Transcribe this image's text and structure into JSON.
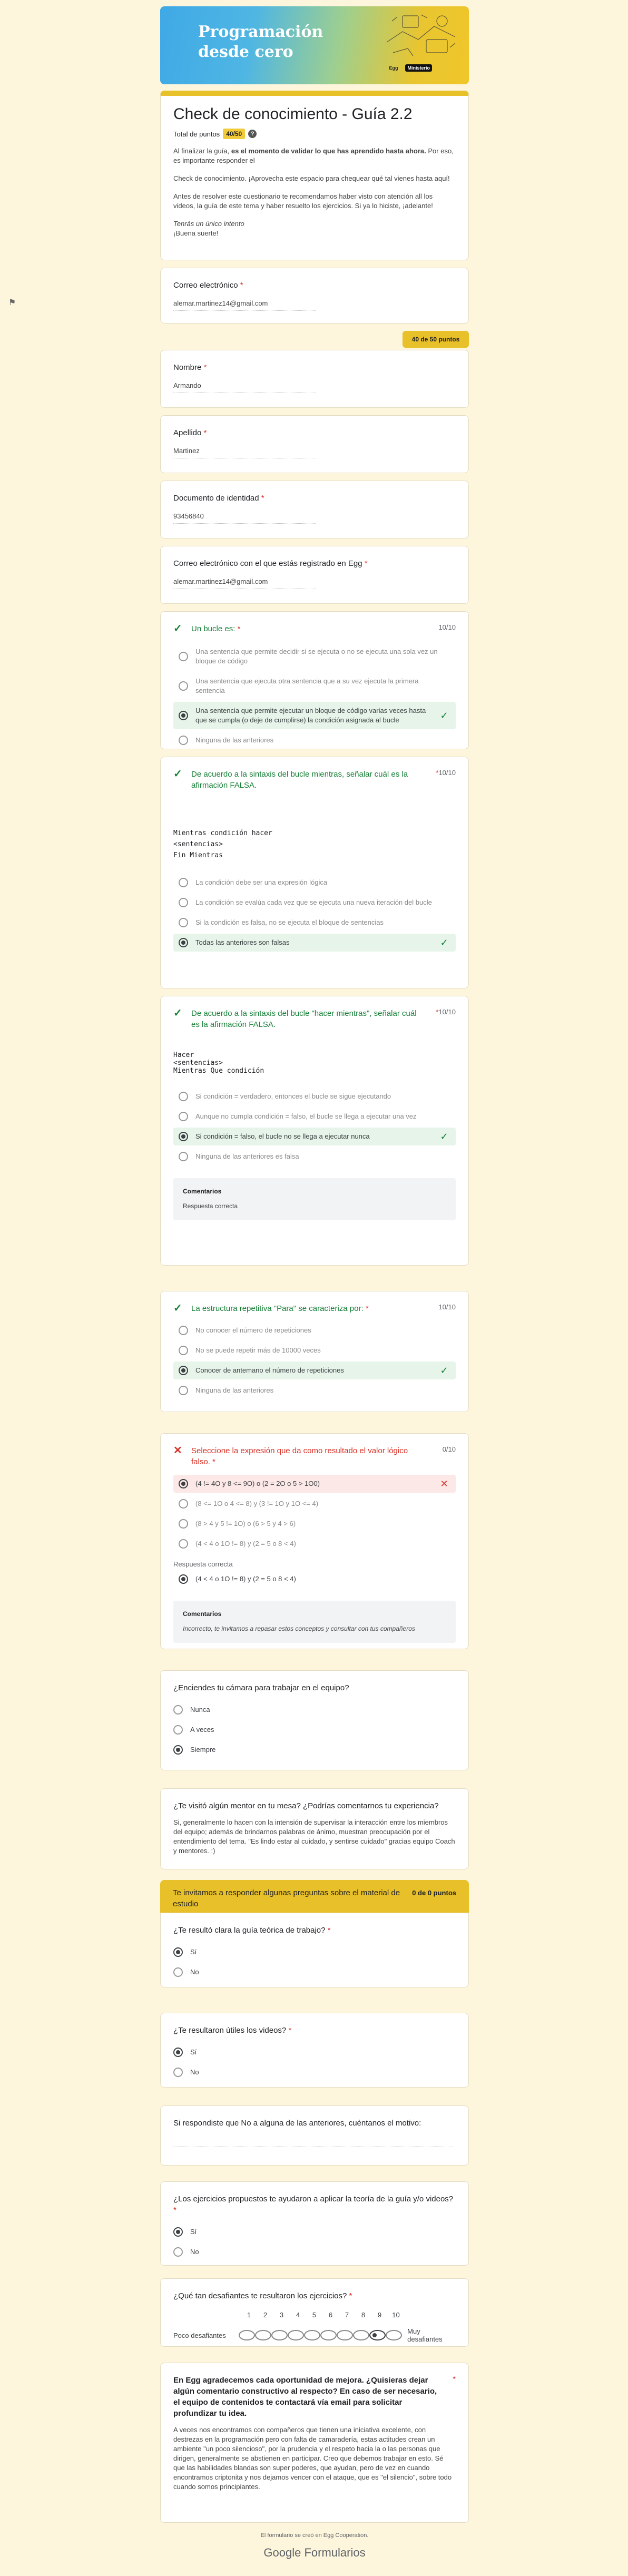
{
  "banner": {
    "title": "Programación desde cero",
    "logo_a": "Egg",
    "logo_b": "Ministerio"
  },
  "form": {
    "title": "Check de conocimiento - Guía 2.2",
    "points_label": "Total de puntos",
    "points_value": "40/50",
    "intro_1a": "Al finalizar la guía,",
    "intro_1b": "es el momento de validar lo que has aprendido hasta ahora.",
    "intro_1c": "Por eso, es importante responder el",
    "intro_2": "Check de conocimiento. ¡Aprovecha este espacio para chequear qué tal vienes hasta aquí!",
    "intro_3": "Antes de resolver este cuestionario te recomendamos haber visto con atención all los videos, la guía de este tema y haber resuelto los ejercicios. Si ya lo hiciste, ¡adelante!",
    "intro_4": "Tenrás un único intento",
    "intro_5": "¡Buena suerte!"
  },
  "email": {
    "label": "Correo electrónico",
    "value": "alemar.martinez14@gmail.com"
  },
  "points_tab": "40 de 50 puntos",
  "nombre": {
    "label": "Nombre",
    "value": "Armando"
  },
  "apellido": {
    "label": "Apellido",
    "value": "Martinez"
  },
  "documento": {
    "label": "Documento de identidad",
    "value": "93456840"
  },
  "egg_email": {
    "label": "Correo electrónico con el que estás registrado en Egg",
    "value": "alemar.martinez14@gmail.com"
  },
  "q1": {
    "title": "Un bucle es:",
    "score": "10/10",
    "options": [
      "Una sentencia que permite decidir si se ejecuta o no se ejecuta una sola vez un bloque de código",
      "Una sentencia que ejecuta otra sentencia que a su vez ejecuta la primera sentencia",
      "Una sentencia que permite ejecutar un bloque de código varias veces hasta que se cumpla (o deje de cumplirse) la condición asignada al bucle",
      "Ninguna de las anteriores"
    ]
  },
  "q2": {
    "title": "De acuerdo a la sintaxis del bucle mientras, señalar cuál es la afirmación FALSA.",
    "score": "10/10",
    "code": "Mientras condición hacer\n<sentencias>\nFin Mientras",
    "options": [
      "La condición debe ser una expresión lógica",
      "La condición se evalúa cada vez que se ejecuta una nueva iteración del bucle",
      "Si la condición es falsa, no se ejecuta el bloque de sentencias",
      "Todas las anteriores son falsas"
    ]
  },
  "q3": {
    "title": "De acuerdo a la sintaxis del bucle \"hacer mientras\", señalar cuál es la afirmación FALSA.",
    "score": "10/10",
    "code": "Hacer\n<sentencias>\nMientras Que condición",
    "options": [
      "Si condición = verdadero, entonces el bucle se sigue ejecutando",
      "Aunque no cumpla condición = falso, el bucle se llega a ejecutar una vez",
      "Si condición = falso, el bucle no se llega a ejecutar nunca",
      "Ninguna de las anteriores es falsa"
    ],
    "feedback_title": "Comentarios",
    "feedback_text": "Respuesta correcta"
  },
  "q4": {
    "title": "La estructura repetitiva \"Para\" se caracteriza por:",
    "score": "10/10",
    "options": [
      "No conocer el número de repeticiones",
      "No se puede repetir más de 10000 veces",
      "Conocer de antemano el número de repeticiones",
      "Ninguna de las anteriores"
    ]
  },
  "q5": {
    "title": "Seleccione la expresión que da como resultado el valor lógico falso.",
    "score": "0/10",
    "options": [
      "(4 != 4O y 8 <= 9O) o (2 = 2O o 5 > 1O0)",
      "(8 <= 1O o 4 <= 8) y (3 != 1O y 1O <= 4)",
      "(8 > 4 y 5 != 1O) o (6 > 5 y 4 > 6)",
      "(4 < 4 o 1O != 8) y (2 = 5 o 8 < 4)"
    ],
    "correct_label": "Respuesta correcta",
    "correct_option": "(4 < 4 o 1O != 8) y (2 = 5 o 8 < 4)",
    "feedback_title": "Comentarios",
    "feedback_text": "Incorrecto, te invitamos a repasar estos conceptos y consultar con tus compañeros"
  },
  "camera": {
    "title": "¿Enciendes tu cámara para trabajar en el equipo?",
    "options": [
      "Nunca",
      "A veces",
      "Siempre"
    ]
  },
  "mentor": {
    "title": "¿Te visitó algún mentor en tu mesa? ¿Podrías comentarnos tu experiencia?",
    "answer": "Si, generalmente lo hacen con la intensión de supervisar la interacción entre los miembros del equipo; además de brindarnos palabras de ánimo, muestran preocupación por el entendimiento del tema. \"Es lindo estar al cuidado, y sentirse cuidado\" gracias equipo Coach y mentores. :)"
  },
  "section": {
    "title": "Te invitamos a responder algunas preguntas sobre el material de estudio",
    "points": "0 de 0 puntos"
  },
  "guia": {
    "title": "¿Te resultó clara la guía teórica de trabajo?",
    "options": [
      "Sí",
      "No"
    ]
  },
  "videos": {
    "title": "¿Te resultaron útiles los videos?",
    "options": [
      "Sí",
      "No"
    ]
  },
  "motivo": {
    "title": "Si respondiste que No a alguna de las anteriores, cuéntanos el motivo:"
  },
  "ejercicios": {
    "title": "¿Los ejercicios propuestos te ayudaron a aplicar la teoría de la guía y/o videos?",
    "options": [
      "Sí",
      "No"
    ]
  },
  "desafio": {
    "title": "¿Qué tan desafiantes te resultaron los ejercicios?",
    "numbers": [
      "1",
      "2",
      "3",
      "4",
      "5",
      "6",
      "7",
      "8",
      "9",
      "10"
    ],
    "low": "Poco desafiantes",
    "high": "Muy desafiantes",
    "selected": 9
  },
  "mejora": {
    "title": "En Egg agradecemos cada oportunidad de mejora. ¿Quisieras dejar algún comentario constructivo al respecto? En caso de ser necesario, el equipo de contenidos te contactará vía email para solicitar profundizar tu idea.",
    "answer": "A veces nos encontramos con compañeros que tienen una iniciativa excelente, con destrezas en la programación pero con falta de camaradería, estas actitudes crean un ambiente \"un poco silencioso\", por la prudencia y el respeto hacia la o las personas que dirigen, generalmente se abstienen en participar. Creo que debemos trabajar en esto. Sé que las habilidades blandas son super poderes, que ayudan, pero de vez en cuando encontramos criptonita y nos dejamos vencer con el ataque, que es \"el silencio\", sobre todo cuando somos principiantes."
  },
  "footer": {
    "line1": "El formulario se creó en Egg Cooperation.",
    "google": "Google",
    "forms": "Formularios"
  },
  "colors": {
    "background": "#fdf6dd",
    "accent": "#e8c02a",
    "correct": "#188038",
    "wrong": "#d93025"
  }
}
